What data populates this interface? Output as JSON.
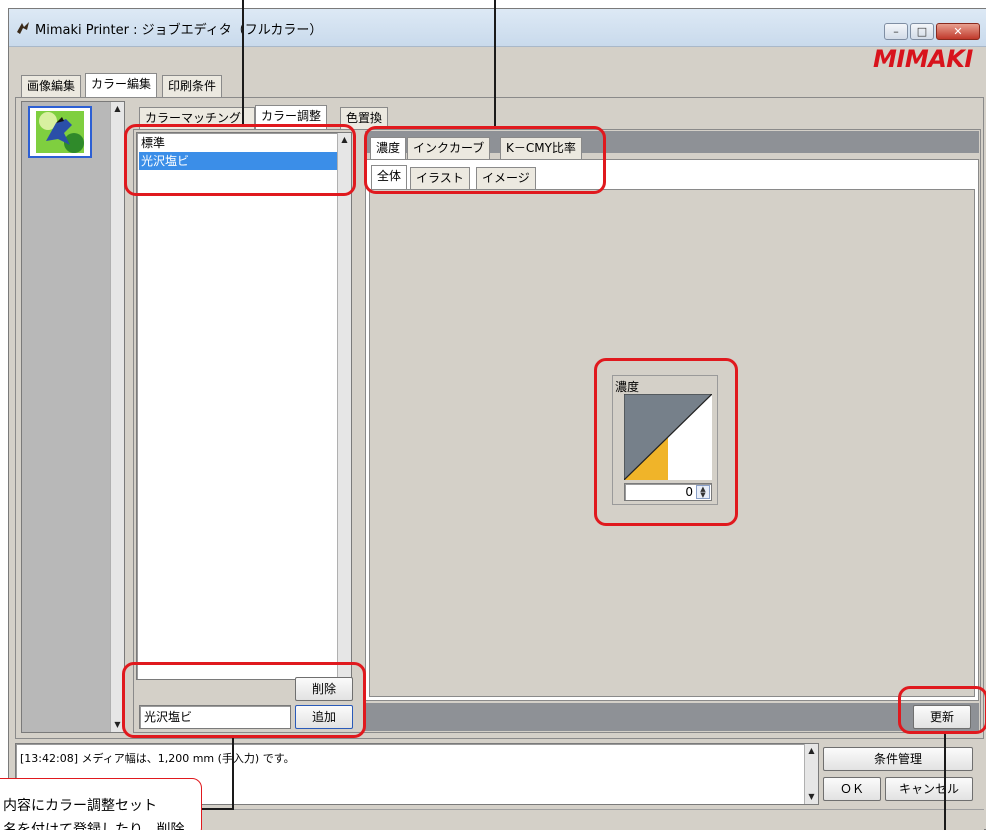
{
  "window": {
    "title": "Mimaki Printer : ジョブエディタ（フルカラー）",
    "brand": "MIMAKI",
    "controls": {
      "minimize": "–",
      "maximize": "□",
      "close": "✕"
    }
  },
  "main_tabs": [
    {
      "label": "画像編集"
    },
    {
      "label": "カラー編集"
    },
    {
      "label": "印刷条件"
    }
  ],
  "color_tabs": [
    {
      "label": "カラーマッチング"
    },
    {
      "label": "カラー調整"
    },
    {
      "label": "色置換"
    }
  ],
  "adjust_sets": {
    "items": [
      "標準",
      "光沢塩ビ"
    ],
    "selected": "光沢塩ビ",
    "name_input_value": "光沢塩ビ",
    "delete_label": "削除",
    "add_label": "追加"
  },
  "adjust_tabs": [
    {
      "label": "濃度"
    },
    {
      "label": "インクカーブ"
    },
    {
      "label": "K－CMY比率"
    }
  ],
  "target_tabs": [
    {
      "label": "全体"
    },
    {
      "label": "イラスト"
    },
    {
      "label": "イメージ"
    }
  ],
  "density": {
    "label": "濃度",
    "value": 0,
    "colors": {
      "background": "#76808a",
      "curve_fill": "#f0b429"
    }
  },
  "update_label": "更新",
  "log": {
    "message": "[13:42:08] メディア幅は、1,200 mm (手入力) です。"
  },
  "footer": {
    "condition_manage": "条件管理",
    "ok": "ＯＫ",
    "cancel": "キャンセル"
  },
  "annotation_text": [
    "内容にカラー調整セット",
    "名を付けて登録したり、削除"
  ],
  "accent_color": "#e0191e"
}
